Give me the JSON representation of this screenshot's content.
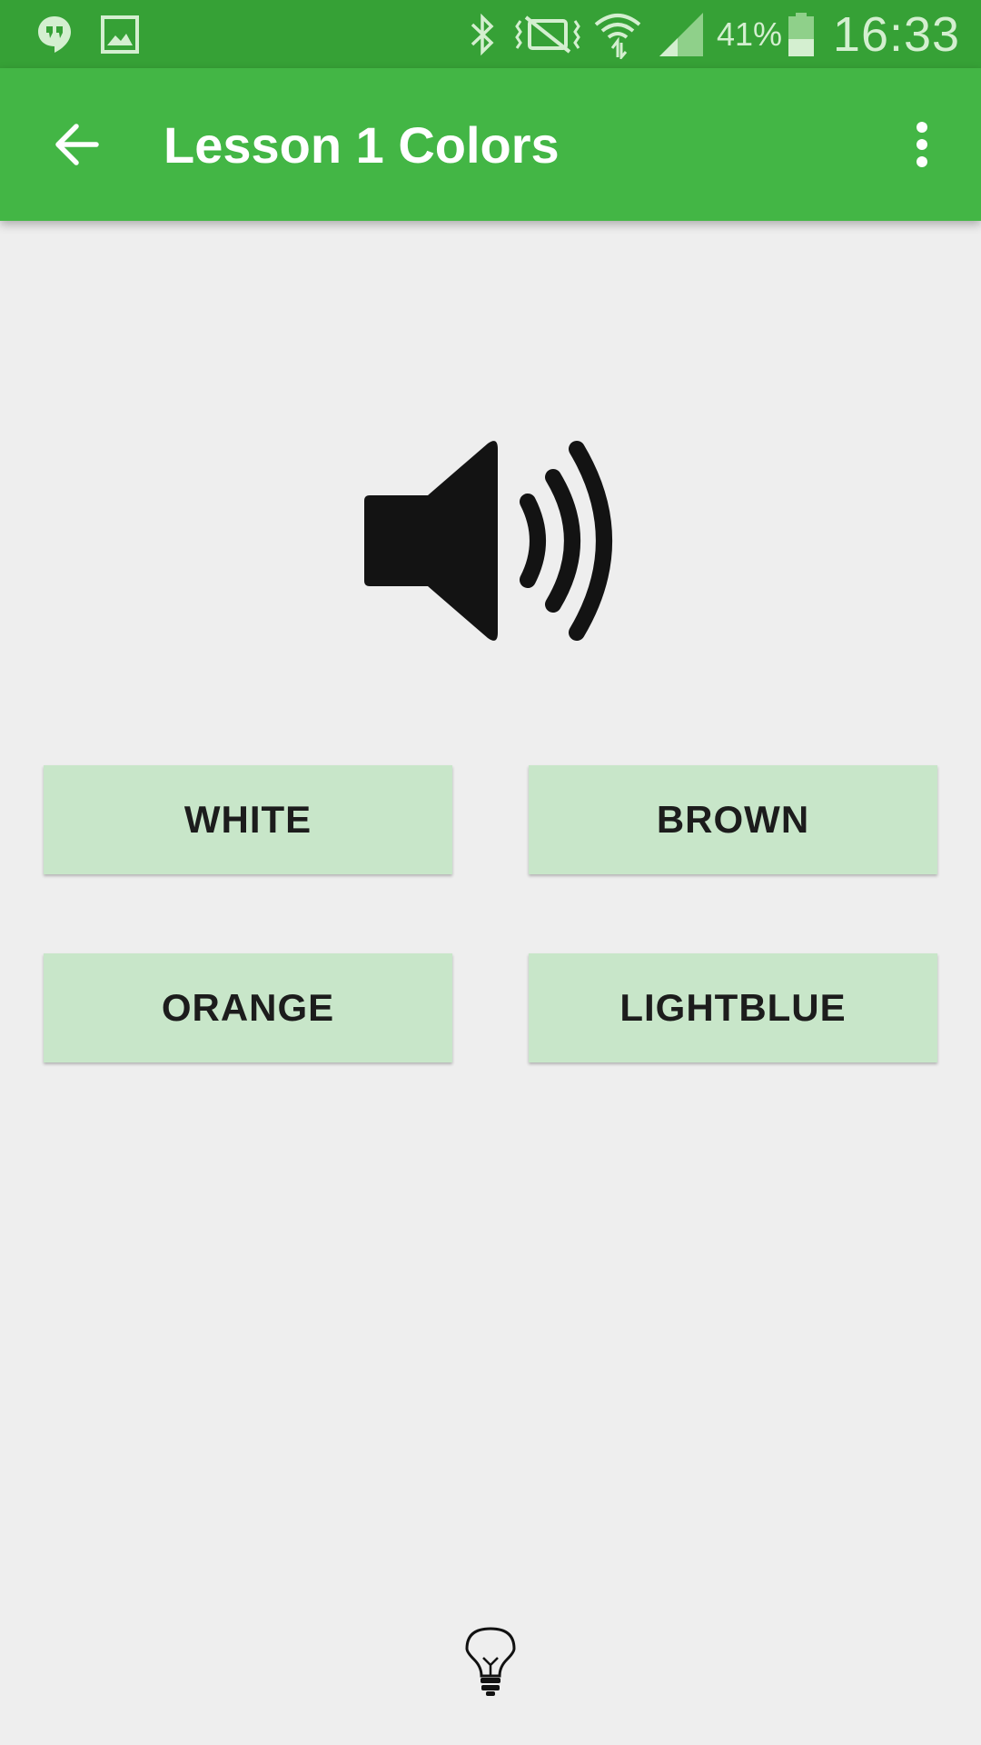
{
  "status_bar": {
    "battery_percent": "41%",
    "clock": "16:33",
    "icons": [
      "hangouts-icon",
      "gallery-icon",
      "bluetooth-icon",
      "vibrate-mute-icon",
      "wifi-icon",
      "signal-icon",
      "battery-icon"
    ]
  },
  "app_bar": {
    "title": "Lesson 1 Colors",
    "back_icon": "arrow-back-icon",
    "menu_icon": "more-vert-icon",
    "color": "#43b645"
  },
  "content": {
    "speaker_icon": "volume-up-icon",
    "answers": {
      "top_left": "WHITE",
      "top_right": "BROWN",
      "bottom_left": "ORANGE",
      "bottom_right": "LIGHTBLUE"
    },
    "answer_color": "#c8e6c9",
    "hint_icon": "lightbulb-icon"
  }
}
